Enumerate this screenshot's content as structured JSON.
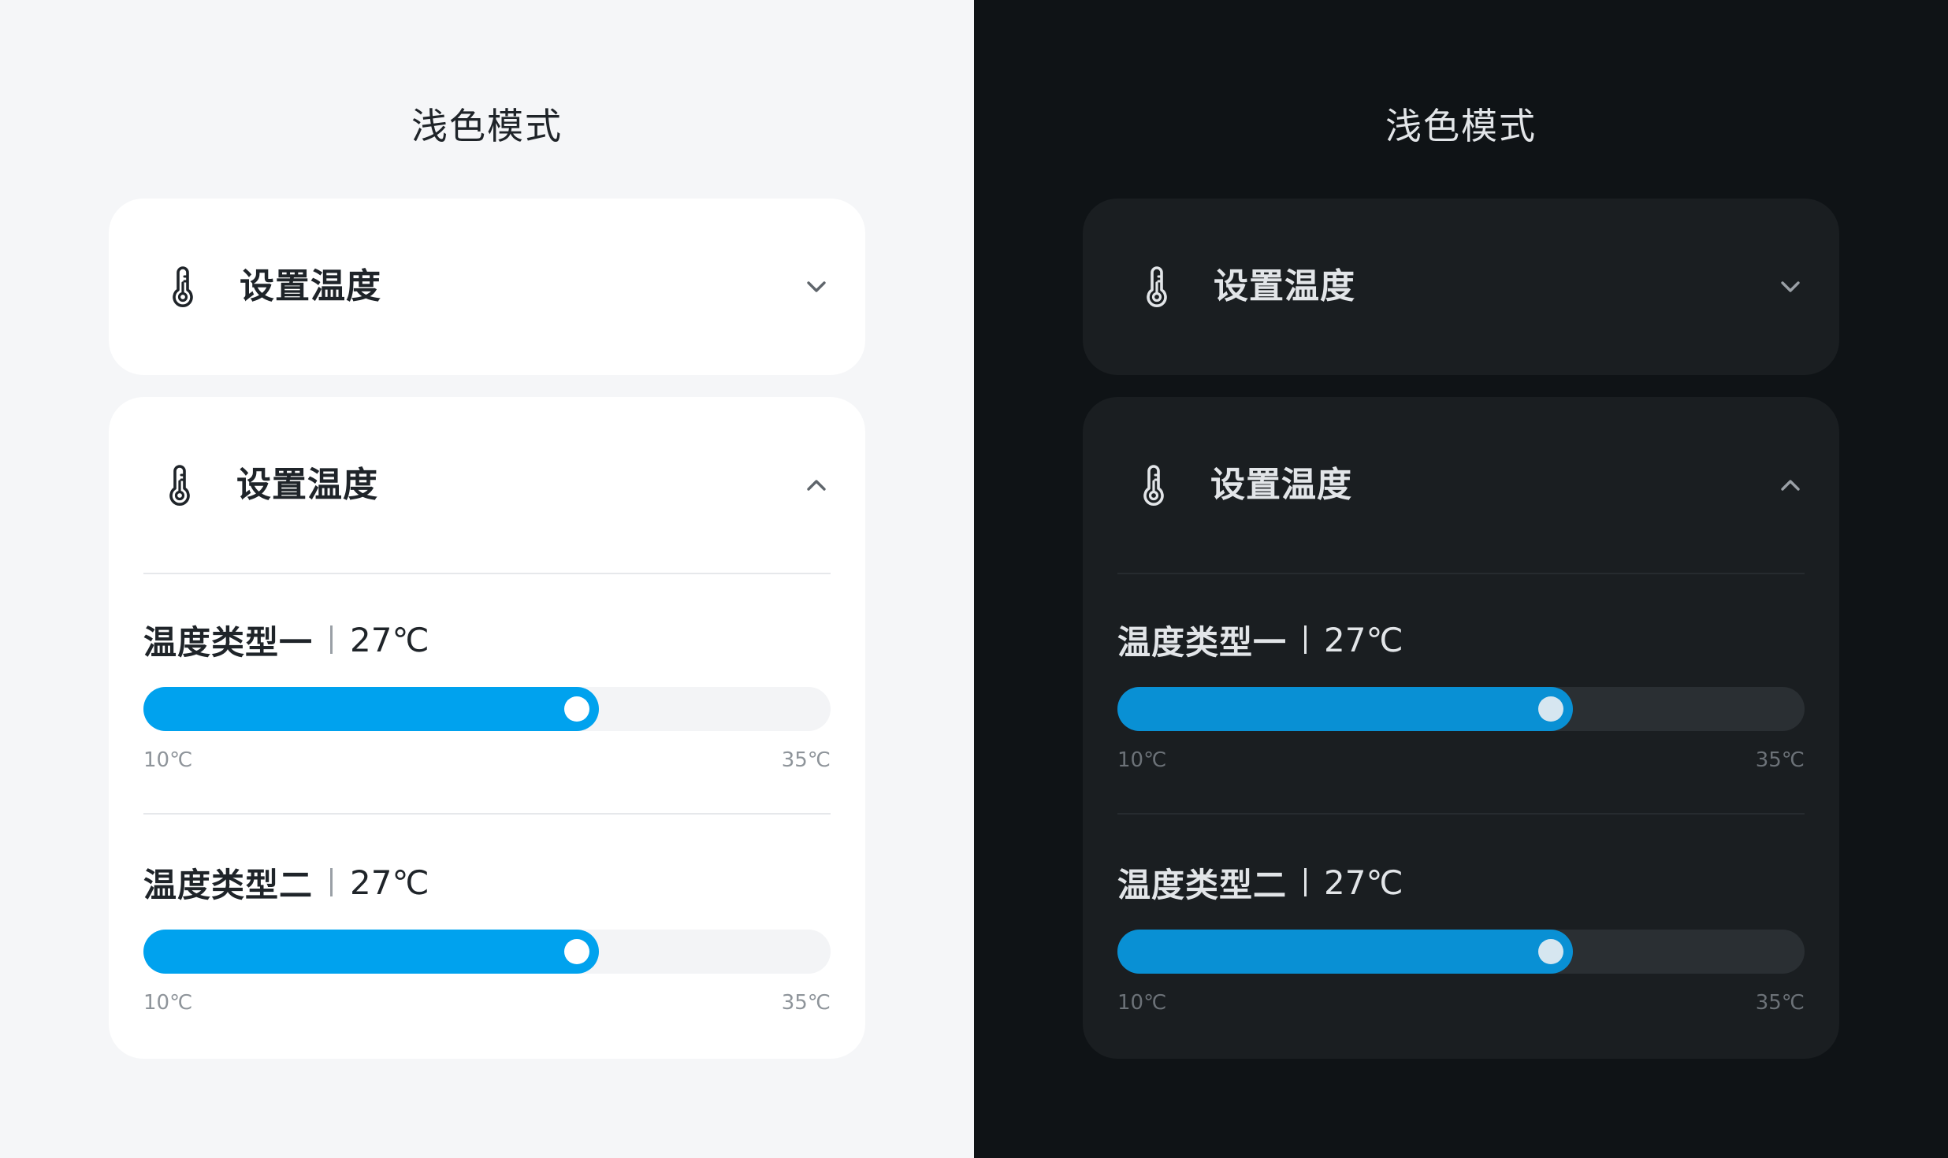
{
  "colors": {
    "light_bg": "#f5f6f8",
    "dark_bg": "#0f1316",
    "light_card": "#ffffff",
    "dark_card": "#1a1e21",
    "light_accent": "#00a2ee",
    "dark_accent": "#0990d4"
  },
  "panels": [
    {
      "theme": "light",
      "title": "浅色模式",
      "collapsed_card": {
        "icon": "thermometer-icon",
        "title": "设置温度",
        "chevron": "chevron-down-icon"
      },
      "expanded_card": {
        "icon": "thermometer-icon",
        "title": "设置温度",
        "chevron": "chevron-up-icon",
        "sliders": [
          {
            "label": "温度类型一",
            "value": "27℃",
            "min": "10℃",
            "max": "35℃",
            "level": 0.663
          },
          {
            "label": "温度类型二",
            "value": "27℃",
            "min": "10℃",
            "max": "35℃",
            "level": 0.663
          }
        ]
      }
    },
    {
      "theme": "dark",
      "title": "浅色模式",
      "collapsed_card": {
        "icon": "thermometer-icon",
        "title": "设置温度",
        "chevron": "chevron-down-icon"
      },
      "expanded_card": {
        "icon": "thermometer-icon",
        "title": "设置温度",
        "chevron": "chevron-up-icon",
        "sliders": [
          {
            "label": "温度类型一",
            "value": "27℃",
            "min": "10℃",
            "max": "35℃",
            "level": 0.663
          },
          {
            "label": "温度类型二",
            "value": "27℃",
            "min": "10℃",
            "max": "35℃",
            "level": 0.663
          }
        ]
      }
    }
  ]
}
